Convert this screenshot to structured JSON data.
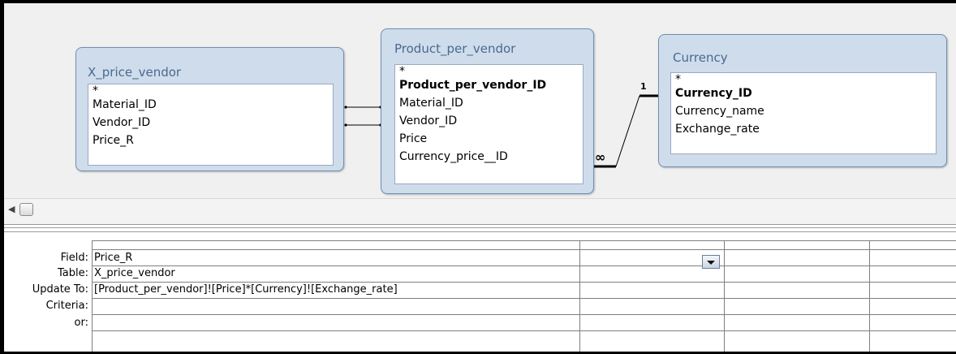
{
  "tables": [
    {
      "title": "X_price_vendor",
      "fields": [
        {
          "label": "*",
          "pk": false
        },
        {
          "label": "Material_ID",
          "pk": false
        },
        {
          "label": "Vendor_ID",
          "pk": false
        },
        {
          "label": "Price_R",
          "pk": false
        }
      ]
    },
    {
      "title": "Product_per_vendor",
      "fields": [
        {
          "label": "*",
          "pk": false
        },
        {
          "label": "Product_per_vendor_ID",
          "pk": true
        },
        {
          "label": "Material_ID",
          "pk": false
        },
        {
          "label": "Vendor_ID",
          "pk": false
        },
        {
          "label": "Price",
          "pk": false
        },
        {
          "label": "Currency_price__ID",
          "pk": false
        }
      ]
    },
    {
      "title": "Currency",
      "fields": [
        {
          "label": "*",
          "pk": false
        },
        {
          "label": "Currency_ID",
          "pk": true
        },
        {
          "label": "Currency_name",
          "pk": false
        },
        {
          "label": "Exchange_rate",
          "pk": false
        }
      ]
    }
  ],
  "relationship": {
    "one_label": "1",
    "many_label": "∞"
  },
  "grid": {
    "row_labels": {
      "field": "Field:",
      "table": "Table:",
      "update_to": "Update To:",
      "criteria": "Criteria:",
      "or": "or:"
    },
    "column1": {
      "field": "Price_R",
      "table": "X_price_vendor",
      "update_to": "[Product_per_vendor]![Price]*[Currency]![Exchange_rate]"
    }
  },
  "icons": {
    "scroll_left": "scroll-left-arrow-icon",
    "dropdown": "dropdown-arrow-icon"
  }
}
